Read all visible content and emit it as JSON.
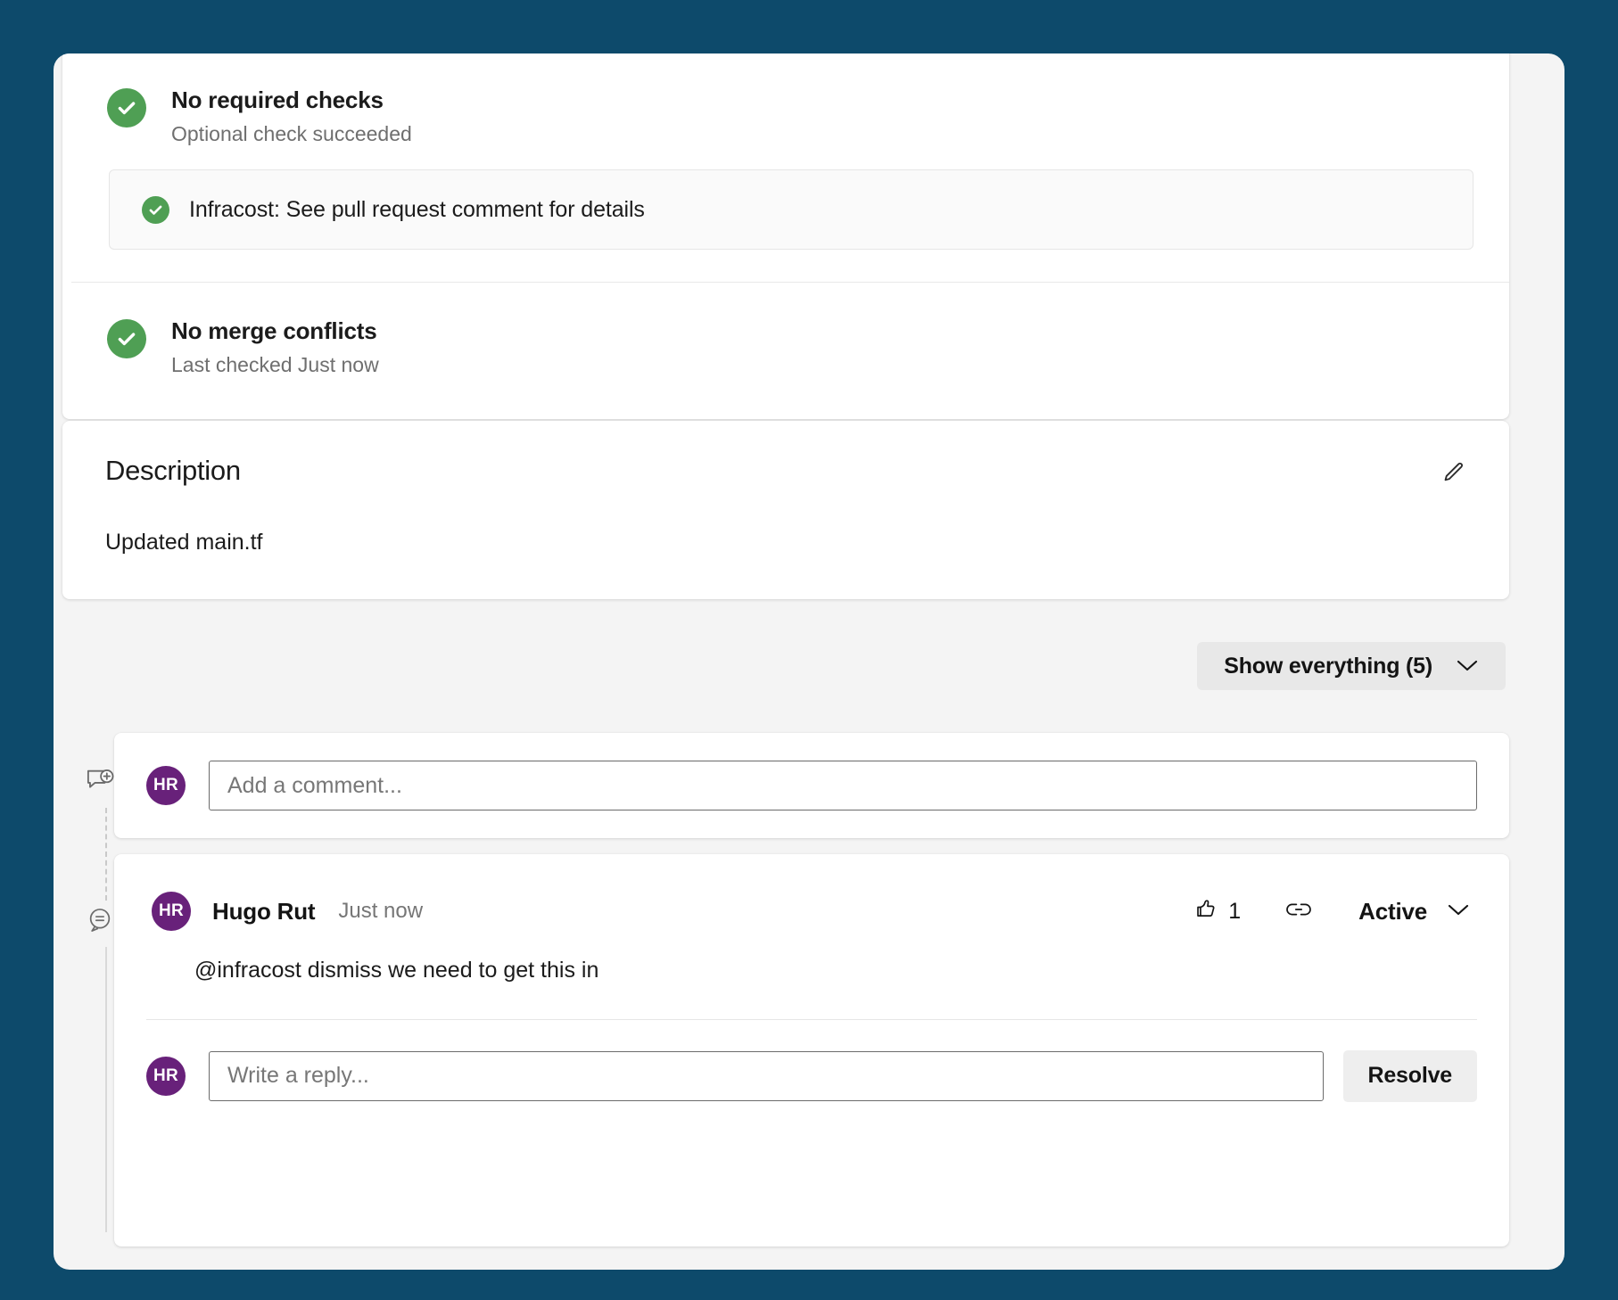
{
  "theme": {
    "page_background": "#0d4a6b",
    "surface_background": "#f4f4f4",
    "card_background": "#ffffff",
    "success_green": "#4f9f54",
    "avatar_purple": "#68217a",
    "button_gray": "#e8e8e8"
  },
  "checks": {
    "required": {
      "title": "No required checks",
      "subtitle": "Optional check succeeded",
      "icon": "check-circle-icon"
    },
    "optional_items": [
      {
        "label": "Infracost: See pull request comment for details",
        "icon": "check-circle-icon"
      }
    ],
    "conflicts": {
      "title": "No merge conflicts",
      "subtitle": "Last checked Just now",
      "icon": "check-circle-icon"
    }
  },
  "description": {
    "title": "Description",
    "body": "Updated main.tf",
    "edit_icon": "pencil-icon"
  },
  "toolbar": {
    "show_everything_label": "Show everything (5)",
    "chevron_icon": "chevron-down-icon"
  },
  "rail": {
    "add_comment_icon": "comment-add-icon",
    "comment_icon": "comment-icon"
  },
  "composer": {
    "avatar_initials": "HR",
    "placeholder": "Add a comment..."
  },
  "thread": {
    "avatar_initials": "HR",
    "author": "Hugo Rut",
    "timestamp": "Just now",
    "body": "@infracost dismiss we need to get this in",
    "like": {
      "icon": "thumbs-up-icon",
      "count": "1"
    },
    "link_icon": "link-icon",
    "status": {
      "label": "Active",
      "chevron_icon": "chevron-down-icon"
    },
    "reply": {
      "avatar_initials": "HR",
      "placeholder": "Write a reply...",
      "resolve_label": "Resolve"
    }
  }
}
